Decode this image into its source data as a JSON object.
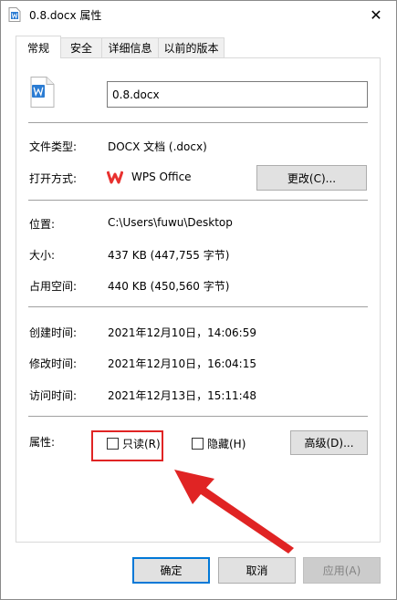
{
  "window": {
    "title": "0.8.docx 属性",
    "close_glyph": "✕"
  },
  "tabs": [
    {
      "label": "常规",
      "active": true
    },
    {
      "label": "安全",
      "active": false
    },
    {
      "label": "详细信息",
      "active": false
    },
    {
      "label": "以前的版本",
      "active": false
    }
  ],
  "general": {
    "file_name": "0.8.docx",
    "file_type_label": "文件类型:",
    "file_type_value": "DOCX 文档 (.docx)",
    "open_with_label": "打开方式:",
    "open_with_value": "WPS Office",
    "change_button": "更改(C)...",
    "location_label": "位置:",
    "location_value": "C:\\Users\\fuwu\\Desktop",
    "size_label": "大小:",
    "size_value": "437 KB (447,755 字节)",
    "disk_size_label": "占用空间:",
    "disk_size_value": "440 KB (450,560 字节)",
    "created_label": "创建时间:",
    "created_value": "2021年12月10日，14:06:59",
    "modified_label": "修改时间:",
    "modified_value": "2021年12月10日，16:04:15",
    "accessed_label": "访问时间:",
    "accessed_value": "2021年12月13日，15:11:48",
    "attributes_label": "属性:",
    "readonly_label": "只读(R)",
    "readonly_checked": false,
    "hidden_label": "隐藏(H)",
    "hidden_checked": false,
    "advanced_button": "高级(D)..."
  },
  "footer": {
    "ok": "确定",
    "cancel": "取消",
    "apply": "应用(A)"
  },
  "colors": {
    "annotation": "#e02424",
    "word_icon": "#2b7cd3",
    "wps_icon": "#e8312f"
  }
}
